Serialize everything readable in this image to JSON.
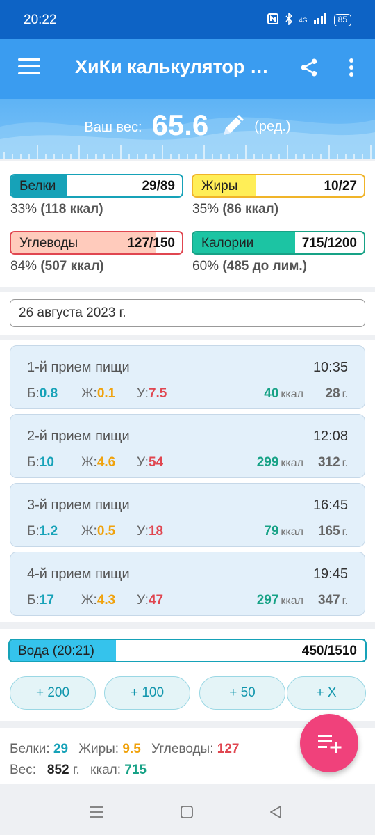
{
  "status": {
    "time": "20:22",
    "network": "4G",
    "battery": "85"
  },
  "appbar": {
    "title": "ХиКи калькулятор БЖУ"
  },
  "weight": {
    "label": "Ваш вес:",
    "value": "65.6",
    "edit_label": "(ред.)"
  },
  "macros": [
    {
      "name": "Белки",
      "value": "29/89",
      "fraction": 0.326,
      "subtitle_pct": "33%",
      "subtitle_detail": "(118 ккал)",
      "border": "#16a2b8",
      "fill": "#16a2b8"
    },
    {
      "name": "Жиры",
      "value": "10/27",
      "fraction": 0.37,
      "subtitle_pct": "35%",
      "subtitle_detail": "(86 ккал)",
      "border": "#f0b429",
      "fill": "#ffee57"
    },
    {
      "name": "Углеводы",
      "value": "127/150",
      "fraction": 0.847,
      "subtitle_pct": "84%",
      "subtitle_detail": "(507 ккал)",
      "border": "#e04650",
      "fill": "#ffcbbc"
    },
    {
      "name": "Калории",
      "value": "715/1200",
      "fraction": 0.596,
      "subtitle_pct": "60%",
      "subtitle_detail": "(485 до лим.)",
      "border": "#17a286",
      "fill": "#1cc4a3"
    }
  ],
  "date": "26 августа 2023 г.",
  "nutrient_labels": {
    "protein": "Б:",
    "fat": "Ж:",
    "carbs": "У:",
    "kcal_unit": "ккал",
    "gram_unit": "г."
  },
  "meals": [
    {
      "title": "1-й прием пищи",
      "time": "10:35",
      "protein": "0.8",
      "fat": "0.1",
      "carbs": "7.5",
      "kcal": "40",
      "grams": "28"
    },
    {
      "title": "2-й прием пищи",
      "time": "12:08",
      "protein": "10",
      "fat": "4.6",
      "carbs": "54",
      "kcal": "299",
      "grams": "312"
    },
    {
      "title": "3-й прием пищи",
      "time": "16:45",
      "protein": "1.2",
      "fat": "0.5",
      "carbs": "18",
      "kcal": "79",
      "grams": "165"
    },
    {
      "title": "4-й прием пищи",
      "time": "19:45",
      "protein": "17",
      "fat": "4.3",
      "carbs": "47",
      "kcal": "297",
      "grams": "347"
    }
  ],
  "water": {
    "label": "Вода (20:21)",
    "value": "450/1510",
    "fraction": 0.298,
    "buttons": [
      "+ 200",
      "+ 100",
      "+ 50",
      "+ X"
    ]
  },
  "summary": {
    "protein_label": "Белки:",
    "protein": "29",
    "fat_label": "Жиры:",
    "fat": "9.5",
    "carbs_label": "Углеводы:",
    "carbs": "127",
    "weight_label": "Вес:",
    "weight": "852",
    "weight_unit": "г.",
    "kcal_label": "ккал:",
    "kcal": "715"
  },
  "colors": {
    "primary": "#3a9cf0",
    "status_bar": "#0d63c5",
    "fab": "#f0417b",
    "protein": "#16a2b8",
    "fat": "#f0a20c",
    "carbs": "#e04650",
    "kcal": "#17a286"
  },
  "icons": {
    "menu": "hamburger-icon",
    "share": "share-icon",
    "more": "more-vert-icon",
    "edit": "pencil-icon",
    "fab": "playlist-add-icon"
  }
}
